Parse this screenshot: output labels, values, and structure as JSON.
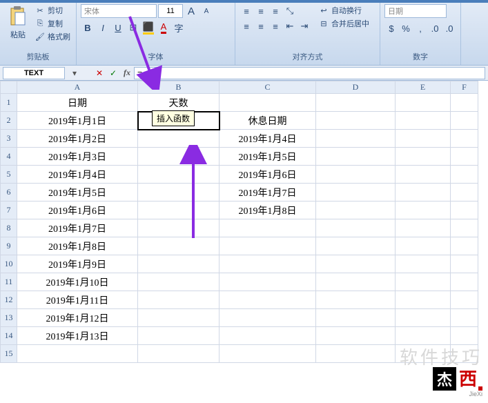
{
  "ribbon": {
    "clipboard": {
      "label": "剪贴板",
      "paste": "粘贴",
      "cut": "剪切",
      "copy": "复制",
      "format_painter": "格式刷"
    },
    "font": {
      "label": "字体",
      "name": "宋体",
      "size": "11"
    },
    "alignment": {
      "label": "对齐方式",
      "wrap": "自动换行",
      "merge": "合并后居中"
    },
    "number": {
      "label": "数字",
      "format": "日期"
    }
  },
  "formula_bar": {
    "name_box": "TEXT",
    "formula": "="
  },
  "tooltip": "插入函数",
  "sheet": {
    "cols": [
      "A",
      "B",
      "C",
      "D",
      "E",
      "F"
    ],
    "rows": [
      {
        "n": 1,
        "A": "日期",
        "B": "天数",
        "C": ""
      },
      {
        "n": 2,
        "A": "2019年1月1日",
        "B": "=",
        "C": "休息日期"
      },
      {
        "n": 3,
        "A": "2019年1月2日",
        "B": "",
        "C": "2019年1月4日"
      },
      {
        "n": 4,
        "A": "2019年1月3日",
        "B": "",
        "C": "2019年1月5日"
      },
      {
        "n": 5,
        "A": "2019年1月4日",
        "B": "",
        "C": "2019年1月6日"
      },
      {
        "n": 6,
        "A": "2019年1月5日",
        "B": "",
        "C": "2019年1月7日"
      },
      {
        "n": 7,
        "A": "2019年1月6日",
        "B": "",
        "C": "2019年1月8日"
      },
      {
        "n": 8,
        "A": "2019年1月7日",
        "B": "",
        "C": ""
      },
      {
        "n": 9,
        "A": "2019年1月8日",
        "B": "",
        "C": ""
      },
      {
        "n": 10,
        "A": "2019年1月9日",
        "B": "",
        "C": ""
      },
      {
        "n": 11,
        "A": "2019年1月10日",
        "B": "",
        "C": ""
      },
      {
        "n": 12,
        "A": "2019年1月11日",
        "B": "",
        "C": ""
      },
      {
        "n": 13,
        "A": "2019年1月12日",
        "B": "",
        "C": ""
      },
      {
        "n": 14,
        "A": "2019年1月13日",
        "B": "",
        "C": ""
      },
      {
        "n": 15,
        "A": "",
        "B": "",
        "C": ""
      }
    ]
  },
  "watermark": {
    "faded": "软件技巧",
    "logo_jie": "杰",
    "logo_xi": "西",
    "sub": "JieXi"
  }
}
